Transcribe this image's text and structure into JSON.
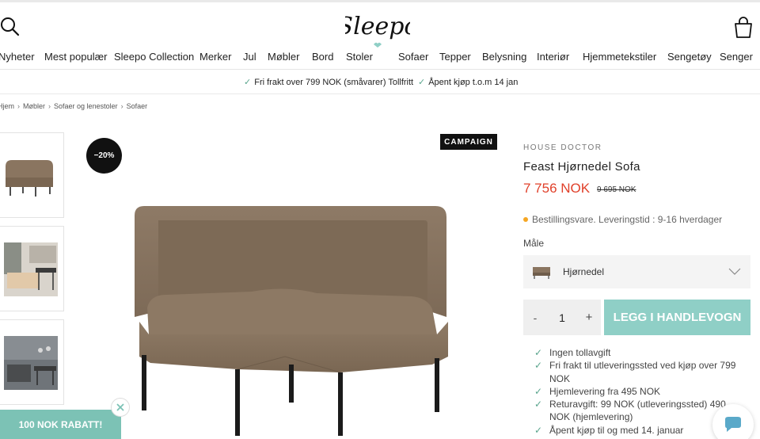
{
  "header": {
    "logo_text": "Sleepo"
  },
  "nav": {
    "items": [
      "Nyheter",
      "Mest populær",
      "Sleepo Collection",
      "Merker",
      "Jul",
      "Møbler",
      "Bord",
      "Stoler",
      "Sofaer",
      "Tepper",
      "Belysning",
      "Interiør",
      "Hjemmetekstiler",
      "Sengetøy",
      "Senger"
    ]
  },
  "usp": {
    "items": [
      "Fri frakt over 799 NOK (småvarer) Tollfritt",
      "Åpent kjøp t.o.m 14 jan"
    ]
  },
  "breadcrumb": [
    "Hjem",
    "Møbler",
    "Sofaer og lenestoler",
    "Sofaer"
  ],
  "gallery": {
    "discount_badge": "−20%",
    "campaign_badge": "CAMPAIGN"
  },
  "product": {
    "brand": "HOUSE DOCTOR",
    "title": "Feast Hjørnedel Sofa",
    "price": "7 756 NOK",
    "old_price": "9 695 NOK",
    "stock_status": "Bestillingsvare. Leveringstid : 9-16 hverdager",
    "variant_label": "Måle",
    "variant_value": "Hjørnedel",
    "quantity": "1",
    "qty_minus": "-",
    "qty_plus": "+",
    "add_to_cart": "LEGG I HANDLEVOGN",
    "benefits": [
      "Ingen tollavgift",
      "Fri frakt til utleveringssted ved kjøp over 799 NOK",
      "Hjemlevering fra 495 NOK",
      "Returavgift: 99 NOK (utleveringssted) 490 NOK (hjemlevering)",
      "Åpent kjøp til og med 14. januar"
    ]
  },
  "promo": {
    "label": "100 NOK RABATT!"
  },
  "colors": {
    "accent_teal": "#8fcfc6",
    "price_red": "#e0402a",
    "check_green": "#5aa58d",
    "stock_orange": "#f5a623"
  },
  "icons": [
    "search-icon",
    "cart-icon",
    "check-icon",
    "chevron-right-icon",
    "chevron-down-icon",
    "close-icon",
    "chat-icon"
  ]
}
